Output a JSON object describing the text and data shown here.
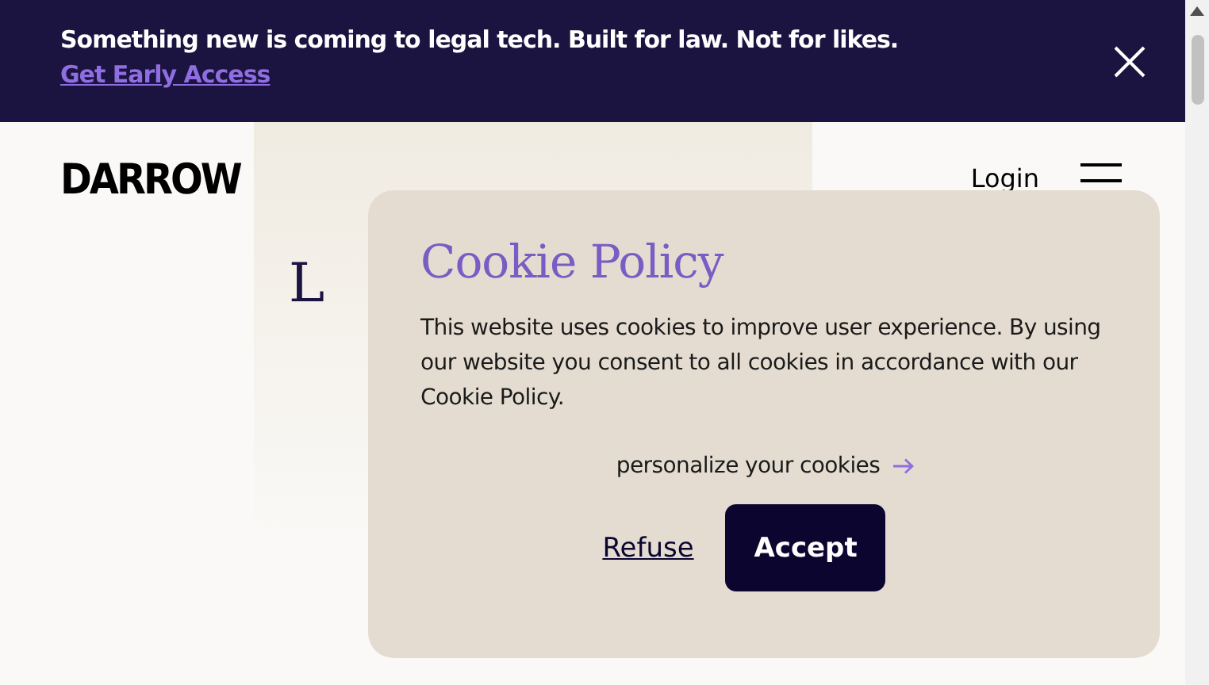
{
  "banner": {
    "message": "Something new is coming to legal tech. Built for law. Not for likes.",
    "link": "Get Early Access"
  },
  "header": {
    "logo": "DARROW",
    "login": "Login"
  },
  "hero": {
    "heading": "L"
  },
  "cookie_dialog": {
    "title": "Cookie Policy",
    "body": "This website uses cookies to improve user experience.  By using our website you consent to all cookies in accordance with our Cookie Policy.",
    "personalize_link": "personalize your cookies",
    "buttons": [
      {
        "label": "Refuse",
        "kind": "link"
      },
      {
        "label": "Accept",
        "kind": "primary"
      }
    ]
  }
}
